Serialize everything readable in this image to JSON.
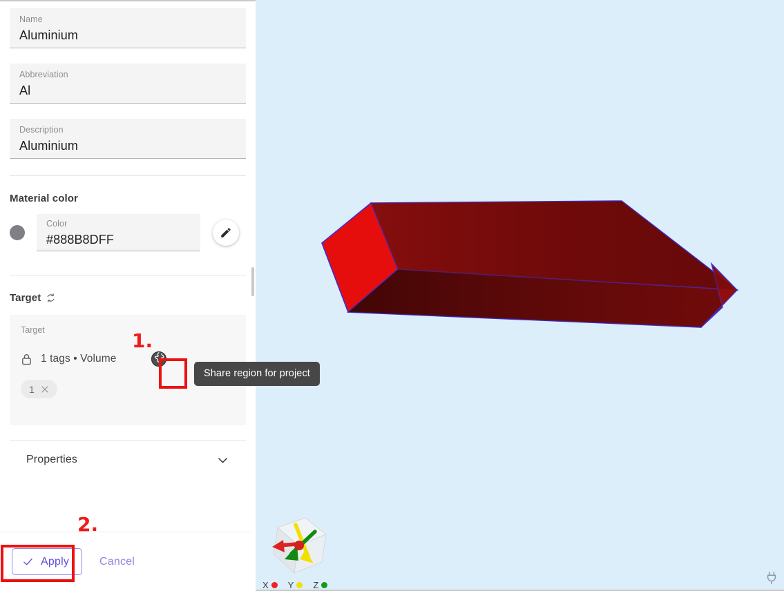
{
  "panel": {
    "fields": [
      {
        "label": "Name",
        "value": "Aluminium",
        "name": "name-field"
      },
      {
        "label": "Abbreviation",
        "value": "Al",
        "name": "abbreviation-field"
      },
      {
        "label": "Description",
        "value": "Aluminium",
        "name": "description-field"
      }
    ],
    "material_color": {
      "section_title": "Material color",
      "swatch_color": "#7e8083",
      "field_label": "Color",
      "field_value": "#888B8DFF",
      "edit_icon": "pencil-icon"
    },
    "target": {
      "section_title": "Target",
      "refresh_icon": "refresh-icon",
      "card_label": "Target",
      "lock_icon": "lock-icon",
      "summary": "1 tags • Volume",
      "globe_icon": "globe-icon",
      "chip_label": "1",
      "chip_remove_icon": "close-icon"
    },
    "properties": {
      "title": "Properties",
      "chevron_icon": "chevron-down-icon"
    },
    "actions": {
      "apply_label": "Apply",
      "apply_check_icon": "check-icon",
      "cancel_label": "Cancel",
      "accent_color": "#5d4de0"
    }
  },
  "tooltip": {
    "text": "Share region for project"
  },
  "annotations": [
    {
      "number": "1.",
      "target": "globe-icon-button"
    },
    {
      "number": "2.",
      "target": "apply-button"
    }
  ],
  "viewport": {
    "background_color": "#ddeefb",
    "model": {
      "name": "aluminium-beam-solid",
      "face_color_bright": "#e60d0d",
      "face_color_dark": "#7a0b0b",
      "edge_color": "#3b2fd6"
    },
    "gizmo": {
      "name": "orientation-cube-gizmo",
      "axes": [
        {
          "label": "X",
          "color": "#ee2222"
        },
        {
          "label": "Y",
          "color": "#f2e000"
        },
        {
          "label": "Z",
          "color": "#149a14"
        }
      ]
    },
    "status_icon": "plug-icon"
  }
}
